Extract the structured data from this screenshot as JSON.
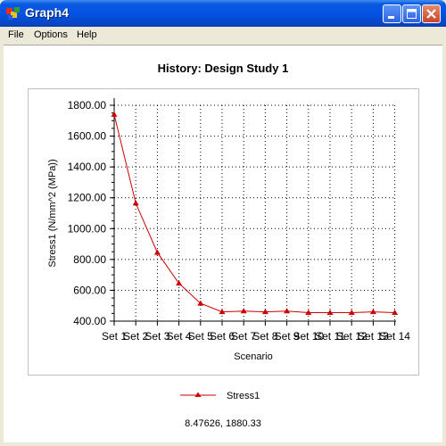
{
  "window": {
    "title": "Graph4",
    "app_icon": "graph-app-icon",
    "controls": [
      "minimize-icon",
      "maximize-icon",
      "close-icon"
    ]
  },
  "menu": {
    "items": [
      "File",
      "Options",
      "Help"
    ]
  },
  "chart_data": {
    "type": "line",
    "title": "History: Design Study 1",
    "xlabel": "Scenario",
    "ylabel": "Stress1 (N/mm^2 (MPa))",
    "categories": [
      "Set 1",
      "Set 2",
      "Set 3",
      "Set 4",
      "Set 5",
      "Set 6",
      "Set 7",
      "Set 8",
      "Set 9",
      "Set 10",
      "Set 11",
      "Set 12",
      "Set 13",
      "Set 14"
    ],
    "y_tick_labels": [
      "400.00",
      "600.00",
      "800.00",
      "1000.00",
      "1200.00",
      "1400.00",
      "1600.00",
      "1800.00"
    ],
    "ylim": [
      400,
      1800
    ],
    "grid": true,
    "legend_position": "bottom",
    "series": [
      {
        "name": "Stress1",
        "color": "#cc0000",
        "marker": "triangle",
        "values": [
          1740,
          1165,
          845,
          645,
          515,
          460,
          465,
          460,
          465,
          455,
          455,
          455,
          460,
          455
        ]
      }
    ]
  },
  "status": {
    "coordinates": "8.47626, 1880.33"
  }
}
